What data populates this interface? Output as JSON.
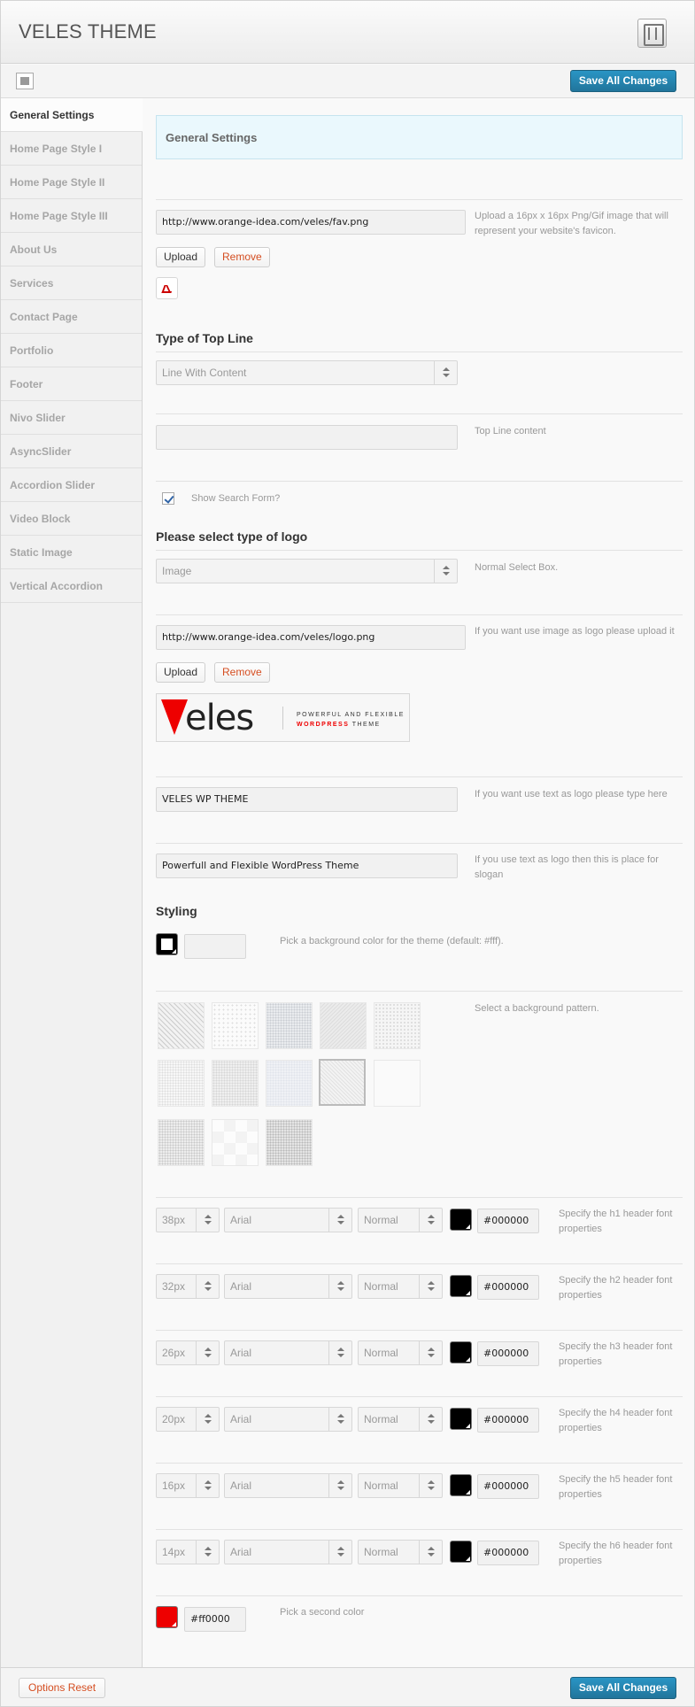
{
  "header": {
    "title": "VELES THEME",
    "save_label": "Save All Changes"
  },
  "sidebar": {
    "items": [
      {
        "label": "General Settings",
        "active": true
      },
      {
        "label": "Home Page Style I"
      },
      {
        "label": "Home Page Style II"
      },
      {
        "label": "Home Page Style III"
      },
      {
        "label": "About Us"
      },
      {
        "label": "Services"
      },
      {
        "label": "Contact Page"
      },
      {
        "label": "Portfolio"
      },
      {
        "label": "Footer"
      },
      {
        "label": "Nivo Slider"
      },
      {
        "label": "AsyncSlider"
      },
      {
        "label": "Accordion Slider"
      },
      {
        "label": "Video Block"
      },
      {
        "label": "Static Image"
      },
      {
        "label": "Vertical Accordion"
      }
    ]
  },
  "main": {
    "section_title": "General Settings",
    "favicon": {
      "value": "http://www.orange-idea.com/veles/fav.png",
      "desc": "Upload a 16px x 16px Png/Gif image that will represent your website's favicon.",
      "upload": "Upload",
      "remove": "Remove"
    },
    "top_line": {
      "heading": "Type of Top Line",
      "select": "Line With Content",
      "content_value": "",
      "content_desc": "Top Line content"
    },
    "search": {
      "label": "Show Search Form?",
      "checked": true
    },
    "logo": {
      "heading": "Please select type of logo",
      "select": "Image",
      "select_desc": "Normal Select Box.",
      "image_value": "http://www.orange-idea.com/veles/logo.png",
      "image_desc": "If you want use image as logo please upload it",
      "upload": "Upload",
      "remove": "Remove",
      "preview_word": "eles",
      "preview_tag1": "POWERFUL AND FLEXIBLE",
      "preview_tag2_red": "WORDPRESS",
      "preview_tag2_rest": " THEME",
      "text_value": "VELES WP THEME",
      "text_desc": "If you want use text as logo please type here",
      "slogan_value": "Powerfull and Flexible WordPress Theme",
      "slogan_desc": "If you use text as logo then this is place for slogan"
    },
    "styling": {
      "heading": "Styling",
      "bg_color_value": "",
      "bg_color_desc": "Pick a background color for the theme (default: #fff).",
      "pattern_desc": "Select a background pattern."
    },
    "fonts": [
      {
        "size": "38px",
        "family": "Arial",
        "weight": "Normal",
        "color": "#000000",
        "desc": "Specify the h1 header font properties"
      },
      {
        "size": "32px",
        "family": "Arial",
        "weight": "Normal",
        "color": "#000000",
        "desc": "Specify the h2 header font properties"
      },
      {
        "size": "26px",
        "family": "Arial",
        "weight": "Normal",
        "color": "#000000",
        "desc": "Specify the h3 header font properties"
      },
      {
        "size": "20px",
        "family": "Arial",
        "weight": "Normal",
        "color": "#000000",
        "desc": "Specify the h4 header font properties"
      },
      {
        "size": "16px",
        "family": "Arial",
        "weight": "Normal",
        "color": "#000000",
        "desc": "Specify the h5 header font properties"
      },
      {
        "size": "14px",
        "family": "Arial",
        "weight": "Normal",
        "color": "#000000",
        "desc": "Specify the h6 header font properties"
      }
    ],
    "second_color": {
      "value": "#ff0000",
      "desc": "Pick a second color"
    }
  },
  "footer": {
    "reset_label": "Options Reset",
    "save_label": "Save All Changes"
  }
}
